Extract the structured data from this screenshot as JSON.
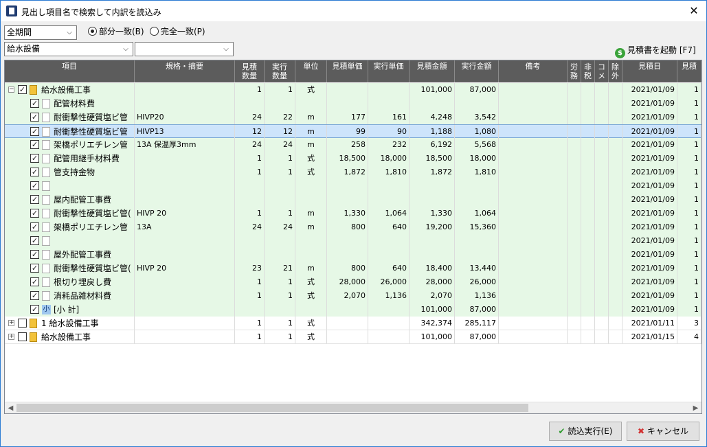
{
  "window": {
    "title": "見出し項目名で検索して内訳を読込み",
    "close_label": "✕"
  },
  "filters": {
    "period": "全期間",
    "match_partial": "部分一致(B)",
    "match_exact": "完全一致(P)",
    "category": "給水設備",
    "subcategory": "",
    "selected_match": "partial"
  },
  "launch_label": "見積書を起動 [F7]",
  "columns": {
    "item": "項目",
    "spec": "規格・摘要",
    "est_qty": [
      "見積",
      "数量"
    ],
    "act_qty": [
      "実行",
      "数量"
    ],
    "unit": "単位",
    "est_price": "見積単価",
    "act_price": "実行単価",
    "est_amount": "見積金額",
    "act_amount": "実行金額",
    "note": "備考",
    "labor": [
      "労",
      "務"
    ],
    "taxfree": [
      "非",
      "税"
    ],
    "comment": [
      "コ",
      "メ"
    ],
    "exclude": [
      "除",
      "外"
    ],
    "date": "見積日",
    "more": "見積"
  },
  "rows": [
    {
      "level": 0,
      "expand": "minus",
      "icon": "doc",
      "checked": true,
      "item": "給水設備工事",
      "spec": "",
      "eq": "1",
      "aq": "1",
      "unit": "式",
      "ep": "",
      "ap": "",
      "ea": "101,000",
      "aa": "87,000",
      "date": "2021/01/09",
      "more": "1",
      "style": "green"
    },
    {
      "level": 1,
      "checked": true,
      "icon": "blank",
      "item": "配管材料費",
      "spec": "",
      "eq": "",
      "aq": "",
      "unit": "",
      "ep": "",
      "ap": "",
      "ea": "",
      "aa": "",
      "date": "2021/01/09",
      "more": "1",
      "style": "green"
    },
    {
      "level": 1,
      "checked": true,
      "icon": "blank",
      "item": "耐衝撃性硬質塩ビ管",
      "spec": "HIVP20",
      "eq": "24",
      "aq": "22",
      "unit": "m",
      "ep": "177",
      "ap": "161",
      "ea": "4,248",
      "aa": "3,542",
      "date": "2021/01/09",
      "more": "1",
      "style": "green"
    },
    {
      "level": 1,
      "checked": true,
      "icon": "blank",
      "item": "耐衝撃性硬質塩ビ管",
      "spec": "HIVP13",
      "eq": "12",
      "aq": "12",
      "unit": "m",
      "ep": "99",
      "ap": "90",
      "ea": "1,188",
      "aa": "1,080",
      "date": "2021/01/09",
      "more": "1",
      "style": "sel"
    },
    {
      "level": 1,
      "checked": true,
      "icon": "blank",
      "item": "架橋ポリエチレン管",
      "spec": "13A 保温厚3mm",
      "eq": "24",
      "aq": "24",
      "unit": "m",
      "ep": "258",
      "ap": "232",
      "ea": "6,192",
      "aa": "5,568",
      "date": "2021/01/09",
      "more": "1",
      "style": "green"
    },
    {
      "level": 1,
      "checked": true,
      "icon": "blank",
      "item": "配管用継手材料費",
      "spec": "",
      "eq": "1",
      "aq": "1",
      "unit": "式",
      "ep": "18,500",
      "ap": "18,000",
      "ea": "18,500",
      "aa": "18,000",
      "date": "2021/01/09",
      "more": "1",
      "style": "green"
    },
    {
      "level": 1,
      "checked": true,
      "icon": "blank",
      "item": "管支持金物",
      "spec": "",
      "eq": "1",
      "aq": "1",
      "unit": "式",
      "ep": "1,872",
      "ap": "1,810",
      "ea": "1,872",
      "aa": "1,810",
      "date": "2021/01/09",
      "more": "1",
      "style": "green"
    },
    {
      "level": 1,
      "checked": true,
      "icon": "blank",
      "item": "",
      "spec": "",
      "eq": "",
      "aq": "",
      "unit": "",
      "ep": "",
      "ap": "",
      "ea": "",
      "aa": "",
      "date": "2021/01/09",
      "more": "1",
      "style": "green"
    },
    {
      "level": 1,
      "checked": true,
      "icon": "blank",
      "item": "屋内配管工事費",
      "spec": "",
      "eq": "",
      "aq": "",
      "unit": "",
      "ep": "",
      "ap": "",
      "ea": "",
      "aa": "",
      "date": "2021/01/09",
      "more": "1",
      "style": "green"
    },
    {
      "level": 1,
      "checked": true,
      "icon": "blank",
      "item": "耐衝撃性硬質塩ビ管(",
      "spec": "HIVP 20",
      "eq": "1",
      "aq": "1",
      "unit": "m",
      "ep": "1,330",
      "ap": "1,064",
      "ea": "1,330",
      "aa": "1,064",
      "date": "2021/01/09",
      "more": "1",
      "style": "green"
    },
    {
      "level": 1,
      "checked": true,
      "icon": "blank",
      "item": "架橋ポリエチレン管",
      "spec": "13A",
      "eq": "24",
      "aq": "24",
      "unit": "m",
      "ep": "800",
      "ap": "640",
      "ea": "19,200",
      "aa": "15,360",
      "date": "2021/01/09",
      "more": "1",
      "style": "green"
    },
    {
      "level": 1,
      "checked": true,
      "icon": "blank",
      "item": "",
      "spec": "",
      "eq": "",
      "aq": "",
      "unit": "",
      "ep": "",
      "ap": "",
      "ea": "",
      "aa": "",
      "date": "2021/01/09",
      "more": "1",
      "style": "green"
    },
    {
      "level": 1,
      "checked": true,
      "icon": "blank",
      "item": "屋外配管工事費",
      "spec": "",
      "eq": "",
      "aq": "",
      "unit": "",
      "ep": "",
      "ap": "",
      "ea": "",
      "aa": "",
      "date": "2021/01/09",
      "more": "1",
      "style": "green"
    },
    {
      "level": 1,
      "checked": true,
      "icon": "blank",
      "item": "耐衝撃性硬質塩ビ管(",
      "spec": "HIVP 20",
      "eq": "23",
      "aq": "21",
      "unit": "m",
      "ep": "800",
      "ap": "640",
      "ea": "18,400",
      "aa": "13,440",
      "date": "2021/01/09",
      "more": "1",
      "style": "green"
    },
    {
      "level": 1,
      "checked": true,
      "icon": "blank",
      "item": "根切り埋戻し費",
      "spec": "",
      "eq": "1",
      "aq": "1",
      "unit": "式",
      "ep": "28,000",
      "ap": "26,000",
      "ea": "28,000",
      "aa": "26,000",
      "date": "2021/01/09",
      "more": "1",
      "style": "green"
    },
    {
      "level": 1,
      "checked": true,
      "icon": "blank",
      "item": "消耗品雑材料費",
      "spec": "",
      "eq": "1",
      "aq": "1",
      "unit": "式",
      "ep": "2,070",
      "ap": "1,136",
      "ea": "2,070",
      "aa": "1,136",
      "date": "2021/01/09",
      "more": "1",
      "style": "green"
    },
    {
      "level": 1,
      "checked": true,
      "icon": "ko",
      "icon_label": "小",
      "item": "[小 計]",
      "spec": "",
      "eq": "",
      "aq": "",
      "unit": "",
      "ep": "",
      "ap": "",
      "ea": "101,000",
      "aa": "87,000",
      "date": "2021/01/09",
      "more": "1",
      "style": "green"
    },
    {
      "level": 0,
      "expand": "plus",
      "icon": "doc",
      "checked": false,
      "item": "1 給水設備工事",
      "spec": "",
      "eq": "1",
      "aq": "1",
      "unit": "式",
      "ep": "",
      "ap": "",
      "ea": "342,374",
      "aa": "285,117",
      "date": "2021/01/11",
      "more": "3",
      "style": "white"
    },
    {
      "level": 0,
      "expand": "plus",
      "icon": "doc",
      "checked": false,
      "item": "給水設備工事",
      "spec": "",
      "eq": "1",
      "aq": "1",
      "unit": "式",
      "ep": "",
      "ap": "",
      "ea": "101,000",
      "aa": "87,000",
      "date": "2021/01/15",
      "more": "4",
      "style": "white"
    }
  ],
  "buttons": {
    "load": "読込実行(E)",
    "cancel": "キャンセル"
  },
  "colors": {
    "header_bg": "#5c5c5c",
    "row_green": "#e6f8e6",
    "row_selected": "#cde4fb",
    "title_border": "#2b7bd3"
  }
}
